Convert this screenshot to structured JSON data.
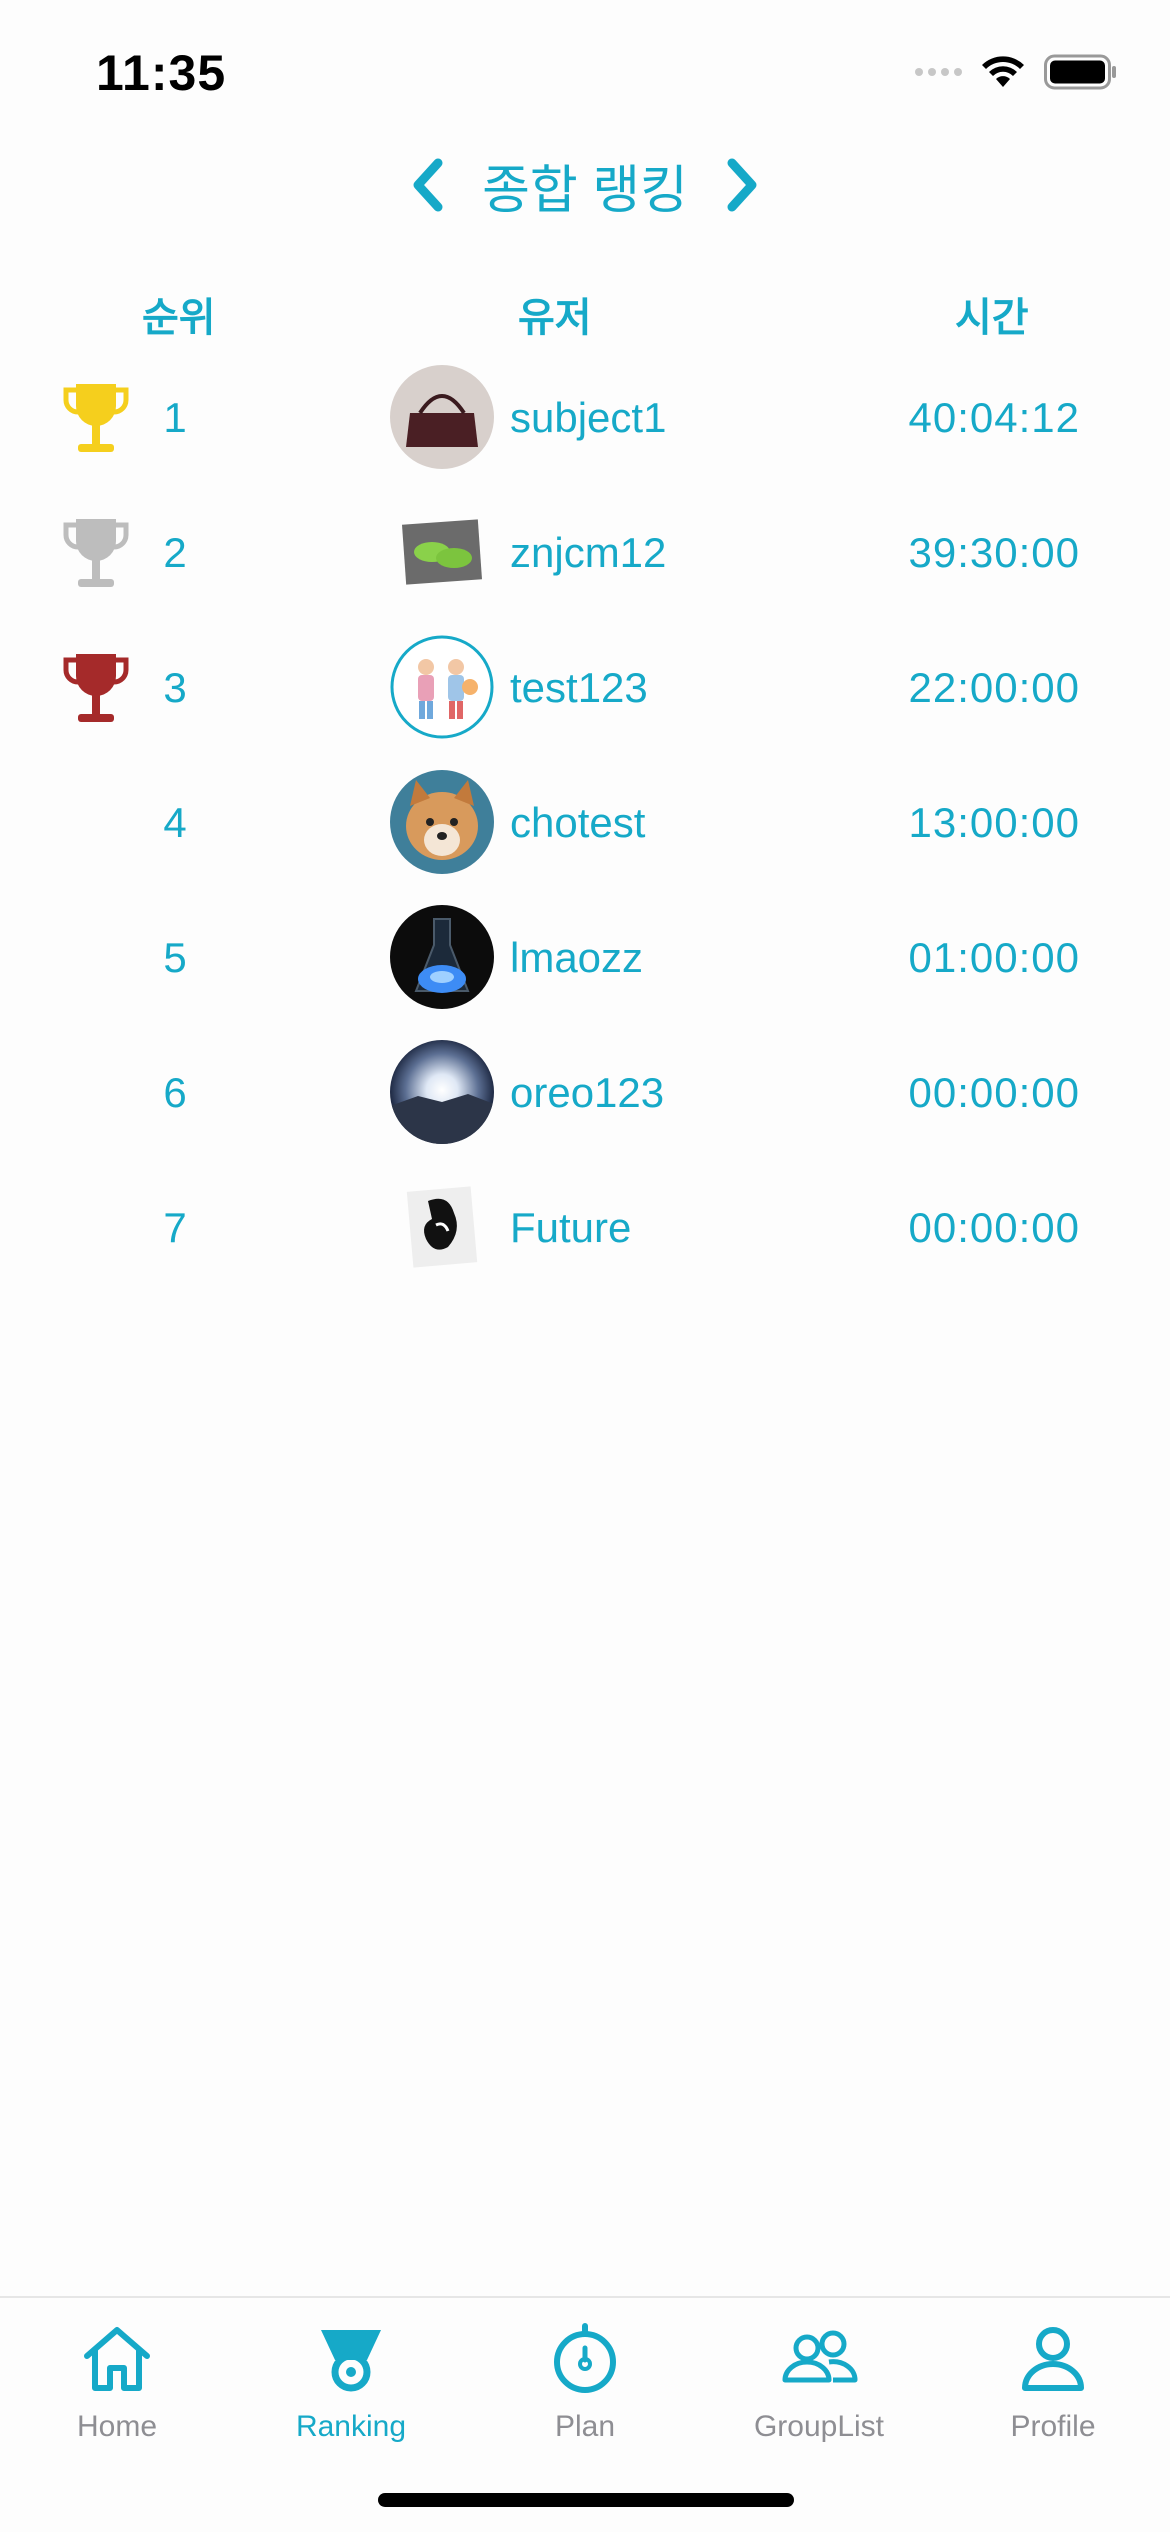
{
  "status": {
    "time": "11:35"
  },
  "header": {
    "title": "종합 랭킹"
  },
  "columns": {
    "rank": "순위",
    "user": "유저",
    "time": "시간"
  },
  "colors": {
    "accent": "#16a9c8",
    "gold": "#f5cf1d",
    "silver": "#bdbdbd",
    "bronze": "#a52a2a",
    "inactive": "#8e8e93"
  },
  "rows": [
    {
      "rank": "1",
      "username": "subject1",
      "time": "40:04:12",
      "trophy": "gold-trophy-icon"
    },
    {
      "rank": "2",
      "username": "znjcm12",
      "time": "39:30:00",
      "trophy": "silver-trophy-icon"
    },
    {
      "rank": "3",
      "username": "test123",
      "time": "22:00:00",
      "trophy": "bronze-trophy-icon"
    },
    {
      "rank": "4",
      "username": "chotest",
      "time": "13:00:00"
    },
    {
      "rank": "5",
      "username": "lmaozz",
      "time": "01:00:00"
    },
    {
      "rank": "6",
      "username": "oreo123",
      "time": "00:00:00"
    },
    {
      "rank": "7",
      "username": "Future",
      "time": "00:00:00"
    }
  ],
  "tabs": [
    {
      "label": "Home",
      "icon": "home-icon"
    },
    {
      "label": "Ranking",
      "icon": "ranking-icon",
      "active": true
    },
    {
      "label": "Plan",
      "icon": "stopwatch-icon"
    },
    {
      "label": "GroupList",
      "icon": "group-icon"
    },
    {
      "label": "Profile",
      "icon": "profile-icon"
    }
  ]
}
